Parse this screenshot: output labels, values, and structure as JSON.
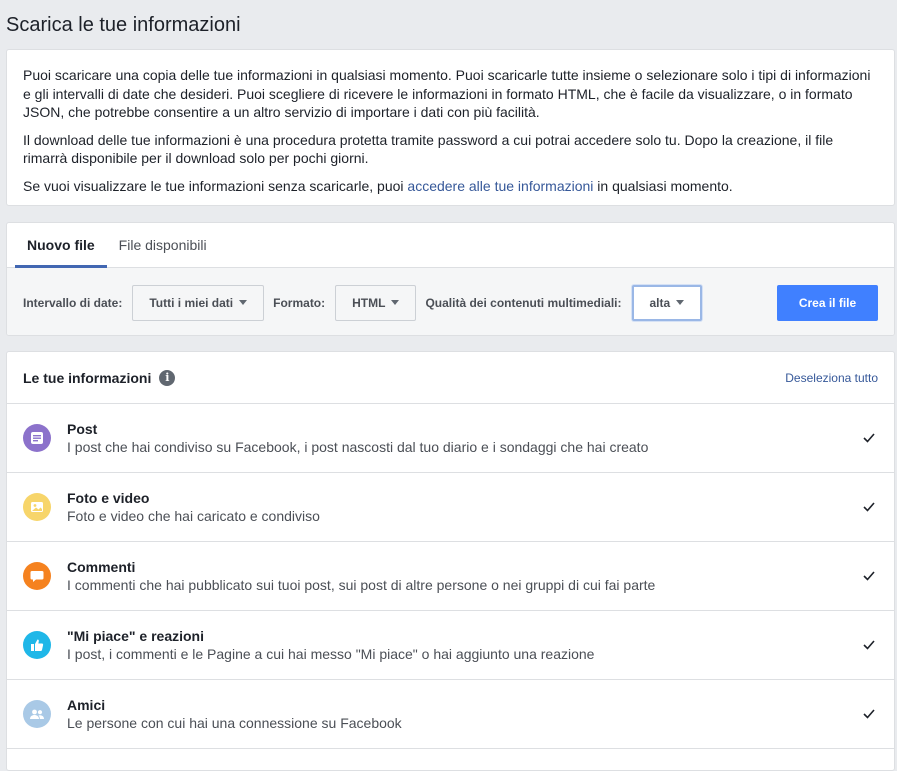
{
  "page_title": "Scarica le tue informazioni",
  "intro": {
    "p1": "Puoi scaricare una copia delle tue informazioni in qualsiasi momento. Puoi scaricarle tutte insieme o selezionare solo i tipi di informazioni e gli intervalli di date che desideri. Puoi scegliere di ricevere le informazioni in formato HTML, che è facile da visualizzare, o in formato JSON, che potrebbe consentire a un altro servizio di importare i dati con più facilità.",
    "p2": "Il download delle tue informazioni è una procedura protetta tramite password a cui potrai accedere solo tu. Dopo la creazione, il file rimarrà disponibile per il download solo per pochi giorni.",
    "p3_before": "Se vuoi visualizzare le tue informazioni senza scaricarle, puoi ",
    "p3_link": "accedere alle tue informazioni",
    "p3_after": " in qualsiasi momento."
  },
  "tabs": [
    {
      "label": "Nuovo file",
      "active": true
    },
    {
      "label": "File disponibili",
      "active": false
    }
  ],
  "filters": {
    "date_label": "Intervallo di date:",
    "date_value": "Tutti i miei dati",
    "format_label": "Formato:",
    "format_value": "HTML",
    "quality_label": "Qualità dei contenuti multimediali:",
    "quality_value": "alta",
    "create_button": "Crea il file"
  },
  "info": {
    "title": "Le tue informazioni",
    "info_icon": "i",
    "deselect_all": "Deseleziona tutto",
    "items": [
      {
        "title": "Post",
        "desc": "I post che hai condiviso su Facebook, i post nascosti dal tuo diario e i sondaggi che hai creato",
        "icon": "post-icon",
        "color": "#8c72cb",
        "checked": true
      },
      {
        "title": "Foto e video",
        "desc": "Foto e video che hai caricato e condiviso",
        "icon": "photo-icon",
        "color": "#f7d56a",
        "checked": true
      },
      {
        "title": "Commenti",
        "desc": "I commenti che hai pubblicato sui tuoi post, sui post di altre persone o nei gruppi di cui fai parte",
        "icon": "comment-icon",
        "color": "#f5821f",
        "checked": true
      },
      {
        "title": "\"Mi piace\" e reazioni",
        "desc": "I post, i commenti e le Pagine a cui hai messo \"Mi piace\" o hai aggiunto una reazione",
        "icon": "like-icon",
        "color": "#1fb7e8",
        "checked": true
      },
      {
        "title": "Amici",
        "desc": "Le persone con cui hai una connessione su Facebook",
        "icon": "friends-icon",
        "color": "#a9c9e6",
        "checked": true
      }
    ]
  },
  "colors": {
    "accent": "#4080ff",
    "link": "#365899",
    "background": "#e9ebee"
  }
}
